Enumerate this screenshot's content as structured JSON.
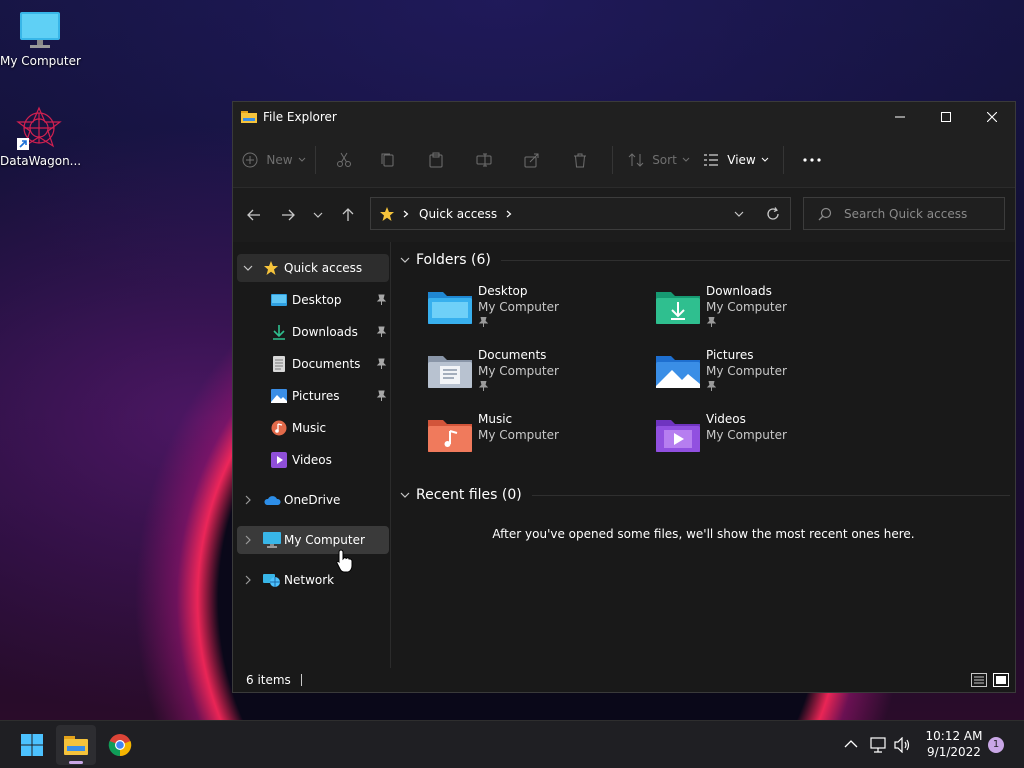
{
  "desktop": {
    "icons": [
      {
        "label": "My Computer"
      },
      {
        "label": "DataWagon..."
      }
    ]
  },
  "window": {
    "title": "File Explorer",
    "toolbar": {
      "new_label": "New",
      "sort_label": "Sort",
      "view_label": "View"
    },
    "address": {
      "location": "Quick access"
    },
    "search": {
      "placeholder": "Search Quick access"
    },
    "sidebar": {
      "quick_access": "Quick access",
      "pinned": [
        {
          "label": "Desktop",
          "pinned": true
        },
        {
          "label": "Downloads",
          "pinned": true
        },
        {
          "label": "Documents",
          "pinned": true
        },
        {
          "label": "Pictures",
          "pinned": true
        },
        {
          "label": "Music",
          "pinned": false
        },
        {
          "label": "Videos",
          "pinned": false
        }
      ],
      "onedrive": "OneDrive",
      "my_computer": "My Computer",
      "network": "Network"
    },
    "content": {
      "folders_header": "Folders (6)",
      "folders": [
        {
          "name": "Desktop",
          "location": "My Computer",
          "pinned": true
        },
        {
          "name": "Downloads",
          "location": "My Computer",
          "pinned": true
        },
        {
          "name": "Documents",
          "location": "My Computer",
          "pinned": true
        },
        {
          "name": "Pictures",
          "location": "My Computer",
          "pinned": true
        },
        {
          "name": "Music",
          "location": "My Computer",
          "pinned": false
        },
        {
          "name": "Videos",
          "location": "My Computer",
          "pinned": false
        }
      ],
      "recent_header": "Recent files (0)",
      "recent_empty": "After you've opened some files, we'll show the most recent ones here."
    },
    "status": {
      "items": "6 items"
    }
  },
  "taskbar": {
    "time": "10:12 AM",
    "date": "9/1/2022",
    "notification_count": "1"
  },
  "colors": {
    "accent": "#4cc2ff",
    "folder_yellow": "#f5c33b",
    "badge": "#c9a7e6"
  }
}
